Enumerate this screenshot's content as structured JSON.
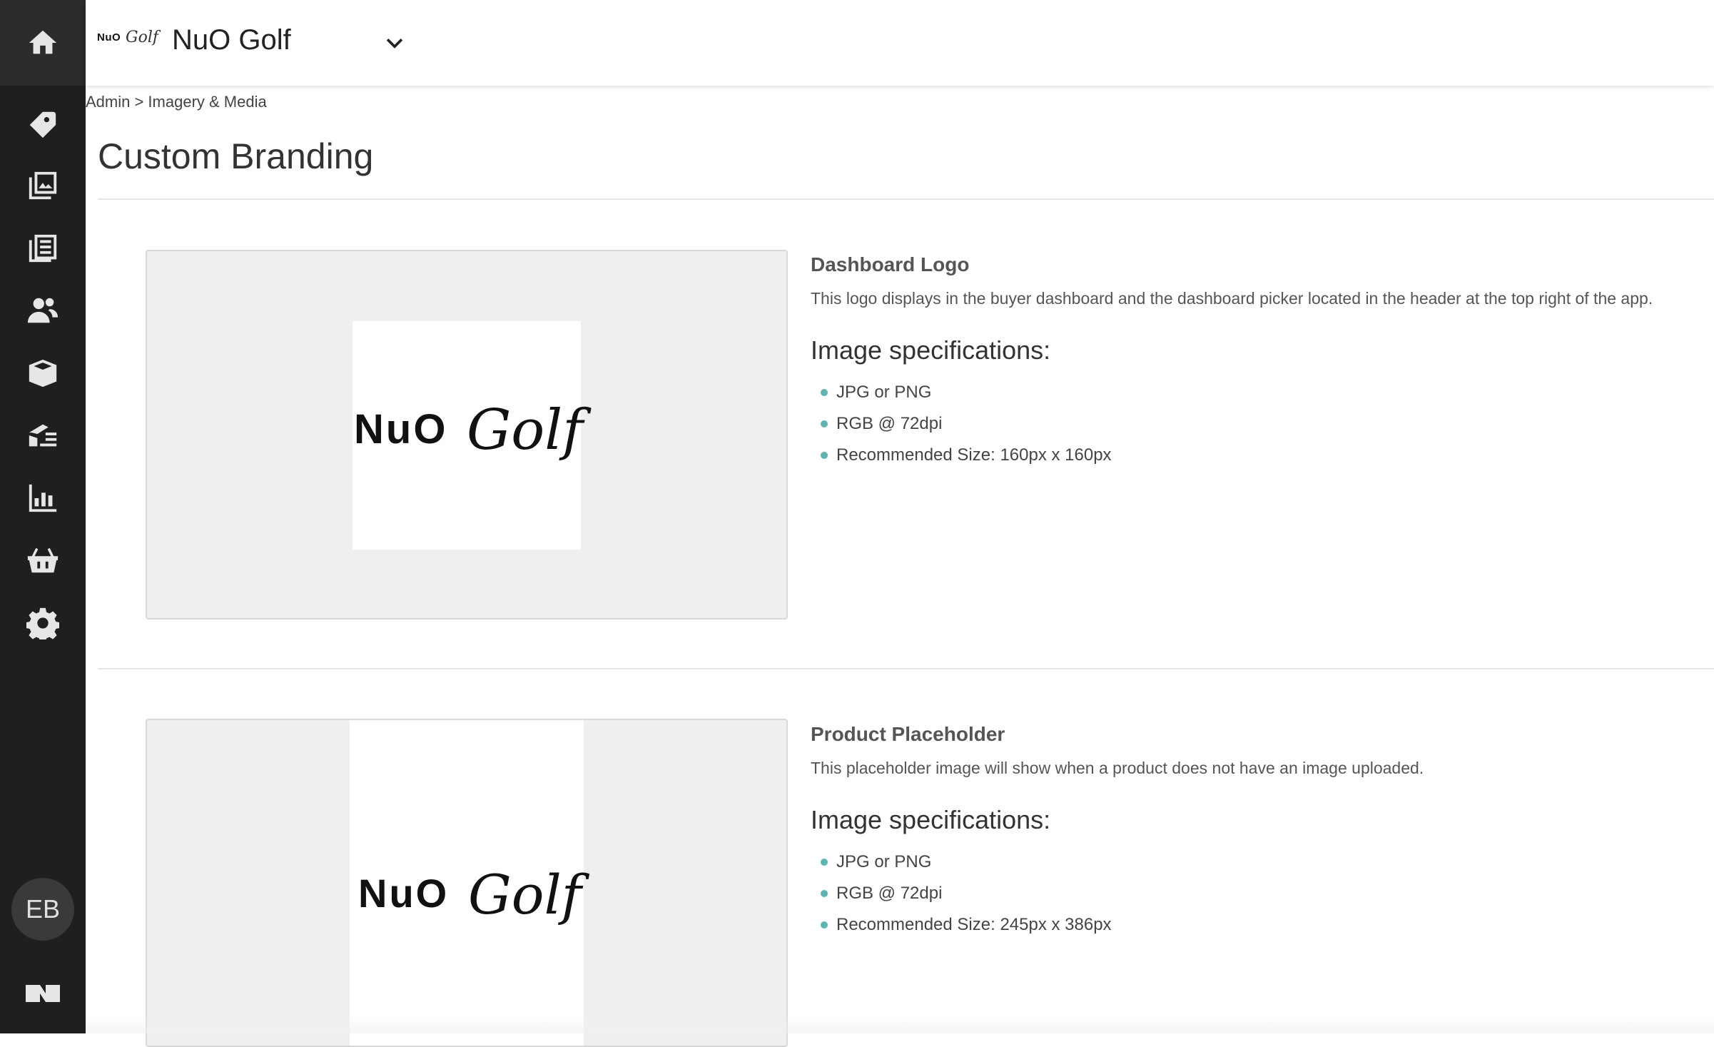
{
  "header": {
    "brand_logo": {
      "word1": "NuO",
      "word2": "Golf"
    },
    "store_name": "NuO Golf"
  },
  "sidebar": {
    "items": [
      {
        "name": "home",
        "icon": "home-icon"
      },
      {
        "name": "tags",
        "icon": "tag-icon"
      },
      {
        "name": "imagery",
        "icon": "images-icon"
      },
      {
        "name": "catalog",
        "icon": "document-list-icon"
      },
      {
        "name": "users",
        "icon": "users-icon"
      },
      {
        "name": "products",
        "icon": "box-icon"
      },
      {
        "name": "orders",
        "icon": "envelope-list-icon"
      },
      {
        "name": "reports",
        "icon": "bar-chart-icon"
      },
      {
        "name": "basket",
        "icon": "basket-icon"
      },
      {
        "name": "settings",
        "icon": "gear-icon"
      }
    ],
    "avatar_initials": "EB"
  },
  "breadcrumb": "Admin > Imagery & Media",
  "page_title": "Custom Branding",
  "sections": [
    {
      "heading": "Dashboard Logo",
      "description": "This logo displays in the buyer dashboard and the dashboard picker located in the header at the top right of the app.",
      "spec_title": "Image specifications:",
      "specs": [
        "JPG or PNG",
        "RGB @ 72dpi",
        "Recommended Size: 160px x 160px"
      ],
      "logo": {
        "word1": "NuO",
        "word2": "Golf"
      }
    },
    {
      "heading": "Product Placeholder",
      "description": "This placeholder image will show when a product does not have an image uploaded.",
      "spec_title": "Image specifications:",
      "specs": [
        "JPG or PNG",
        "RGB @ 72dpi",
        "Recommended Size: 245px x 386px"
      ],
      "logo": {
        "word1": "NuO",
        "word2": "Golf"
      }
    }
  ],
  "colors": {
    "sidebar_bg": "#1f1f1f",
    "bullet": "#5fb3b3",
    "card_bg": "#efefef"
  }
}
